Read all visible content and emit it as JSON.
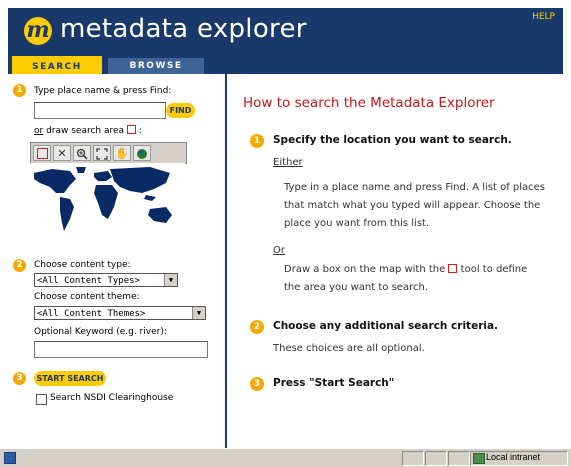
{
  "header": {
    "logo_letter": "m",
    "title": "metadata explorer",
    "help": "HELP"
  },
  "tabs": [
    {
      "label": "SEARCH",
      "active": true
    },
    {
      "label": "BROWSE",
      "active": false
    }
  ],
  "search_panel": {
    "step1": {
      "number": "1",
      "label": "Type place name & press Find:",
      "input_value": "",
      "find_button": "FIND",
      "or_text": "or",
      "draw_text": "draw search area",
      "draw_colon": ":"
    },
    "map_tools": [
      "draw-box",
      "clear",
      "zoom-in",
      "full-extent",
      "pan",
      "globe"
    ],
    "step2": {
      "number": "2",
      "content_type_label": "Choose content type:",
      "content_type_value": "<All Content Types>",
      "content_theme_label": "Choose content theme:",
      "content_theme_value": "<All Content Themes>",
      "keyword_label": "Optional Keyword (e.g. river):",
      "keyword_value": ""
    },
    "step3": {
      "number": "3",
      "start_button": "START SEARCH",
      "nsdi_label": "Search NSDI Clearinghouse",
      "nsdi_checked": false
    }
  },
  "help_panel": {
    "title": "How to search the Metadata Explorer",
    "step1": {
      "number": "1",
      "heading": "Specify the location you want to search.",
      "either": "Either",
      "either_text": "Type in a place name and press Find. A list of places that match what you typed will appear. Choose the place you want from this list.",
      "or": "Or",
      "or_text_before": "Draw a box on the map with the",
      "or_text_after": "tool to define the area you want to search."
    },
    "step2": {
      "number": "2",
      "heading": "Choose any additional search criteria.",
      "text": "These choices are all optional."
    },
    "step3": {
      "number": "3",
      "heading": "Press \"Start Search\""
    }
  },
  "statusbar": {
    "zone": "Local intranet"
  },
  "colors": {
    "header": "#19396b",
    "accent": "#ffcc00",
    "step": "#f5a800",
    "title_red": "#c21818"
  }
}
